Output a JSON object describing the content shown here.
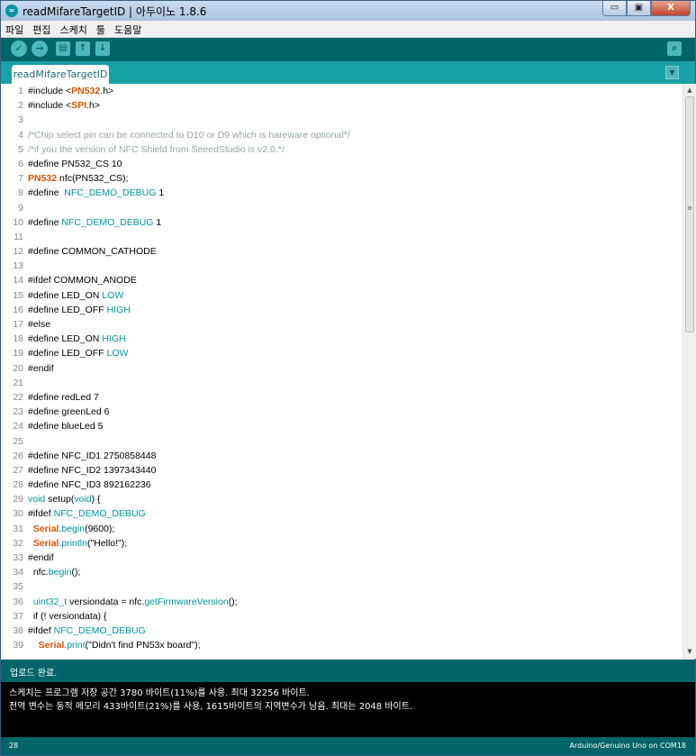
{
  "window": {
    "title": "readMifareTargetID | 아두이노 1.8.6",
    "app_icon_text": "∞",
    "buttons": {
      "minimize": "▭",
      "maximize": "▣",
      "close": "X"
    }
  },
  "menubar": [
    {
      "label": "파일"
    },
    {
      "label": "편집"
    },
    {
      "label": "스케치"
    },
    {
      "label": "툴"
    },
    {
      "label": "도움말"
    }
  ],
  "toolbar": {
    "verify": "✓",
    "upload": "→",
    "new": "▤",
    "open": "↑",
    "save": "↓",
    "serial_monitor": "⌕"
  },
  "tab": {
    "label": "readMifareTargetID §",
    "menu_glyph": "▼"
  },
  "editor": {
    "lines": [
      {
        "n": "1",
        "c": "#include <PN532.h>"
      },
      {
        "n": "2",
        "c": "#include <SPI.h>"
      },
      {
        "n": "3",
        "c": ""
      },
      {
        "n": "4",
        "c": "/*Chip select pin can be connected to D10 or D9 which is hareware optional*/"
      },
      {
        "n": "5",
        "c": "/*if you the version of NFC Shield from SeeedStudio is v2.0.*/"
      },
      {
        "n": "6",
        "c": "#define PN532_CS 10"
      },
      {
        "n": "7",
        "c": "PN532 nfc(PN532_CS);"
      },
      {
        "n": "8",
        "c": "#define  NFC_DEMO_DEBUG 1"
      },
      {
        "n": "9",
        "c": ""
      },
      {
        "n": "10",
        "c": "#define NFC_DEMO_DEBUG 1"
      },
      {
        "n": "11",
        "c": ""
      },
      {
        "n": "12",
        "c": "#define COMMON_CATHODE"
      },
      {
        "n": "13",
        "c": ""
      },
      {
        "n": "14",
        "c": "#ifdef COMMON_ANODE"
      },
      {
        "n": "15",
        "c": "#define LED_ON LOW"
      },
      {
        "n": "16",
        "c": "#define LED_OFF HIGH"
      },
      {
        "n": "17",
        "c": "#else"
      },
      {
        "n": "18",
        "c": "#define LED_ON HIGH"
      },
      {
        "n": "19",
        "c": "#define LED_OFF LOW"
      },
      {
        "n": "20",
        "c": "#endif"
      },
      {
        "n": "21",
        "c": ""
      },
      {
        "n": "22",
        "c": "#define redLed 7"
      },
      {
        "n": "23",
        "c": "#define greenLed 6"
      },
      {
        "n": "24",
        "c": "#define blueLed 5"
      },
      {
        "n": "25",
        "c": ""
      },
      {
        "n": "26",
        "c": "#define NFC_ID1 2750858448"
      },
      {
        "n": "27",
        "c": "#define NFC_ID2 1397343440"
      },
      {
        "n": "28",
        "c": "#define NFC_ID3 892162236"
      },
      {
        "n": "29",
        "c": "void setup(void) {"
      },
      {
        "n": "30",
        "c": "#ifdef NFC_DEMO_DEBUG"
      },
      {
        "n": "31",
        "c": "  Serial.begin(9600);"
      },
      {
        "n": "32",
        "c": "  Serial.println(\"Hello!\");"
      },
      {
        "n": "33",
        "c": "#endif"
      },
      {
        "n": "34",
        "c": "  nfc.begin();"
      },
      {
        "n": "35",
        "c": ""
      },
      {
        "n": "36",
        "c": "  uint32_t versiondata = nfc.getFirmwareVersion();"
      },
      {
        "n": "37",
        "c": "  if (! versiondata) {"
      },
      {
        "n": "38",
        "c": "#ifdef NFC_DEMO_DEBUG"
      },
      {
        "n": "39",
        "c": "    Serial.print(\"Didn't find PN53x board\");"
      }
    ]
  },
  "scroll": {
    "up": "▲",
    "down": "▼",
    "mark": "≡"
  },
  "status": {
    "message": "업로드 완료."
  },
  "console": {
    "lines": [
      "스케치는 프로그램 저장 공간 3780 바이트(11%)를 사용. 최대 32256 바이트.",
      "전역 변수는 동적 메모리 433바이트(21%)를 사용, 1615바이트의 지역변수가 남음.  최대는 2048 바이트."
    ]
  },
  "footer": {
    "line_number": "28",
    "board": "Arduino/Genuino Uno on COM18"
  }
}
